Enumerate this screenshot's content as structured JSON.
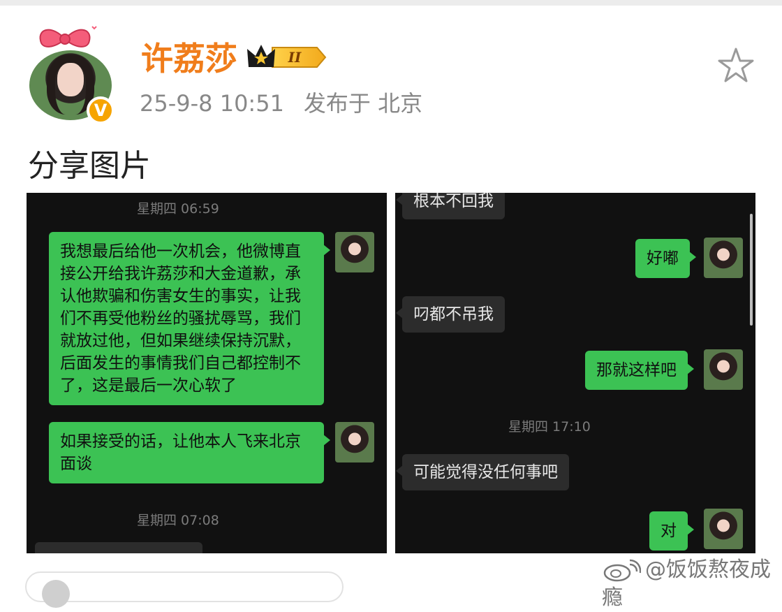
{
  "post": {
    "username": "许荔莎",
    "level_badge": "II",
    "timestamp": "25-9-8 10:51",
    "location": "发布于 北京",
    "text": "分享图片",
    "verified_mark": "V"
  },
  "left_screenshot": {
    "timestamp_1": "星期四 06:59",
    "msg_1": "我想最后给他一次机会，他微博直接公开给我许荔莎和大金道歉，承认他欺骗和伤害女生的事实，让我们不再受他粉丝的骚扰辱骂，我们就放过他，但如果继续保持沉默，后面发生的事情我们自己都控制不了，这是最后一次心软了",
    "msg_2": "如果接受的话，让他本人飞来北京面谈",
    "timestamp_2": "星期四 07:08"
  },
  "right_screenshot": {
    "msg_1": "根本不回我",
    "msg_2": "好嘟",
    "msg_3": "叼都不吊我",
    "msg_4": "那就这样吧",
    "timestamp_1": "星期四 17:10",
    "msg_5": "可能觉得没任何事吧",
    "msg_6": "对"
  },
  "watermark": "@饭饭熬夜成瘾",
  "icons": [
    "star-icon",
    "verified-badge-icon",
    "crown-level-icon",
    "weibo-logo"
  ],
  "colors": {
    "username": "#f07d1b",
    "bubble_me": "#3cc254",
    "bubble_other": "#2c2c2c",
    "verified": "#f6a400"
  }
}
